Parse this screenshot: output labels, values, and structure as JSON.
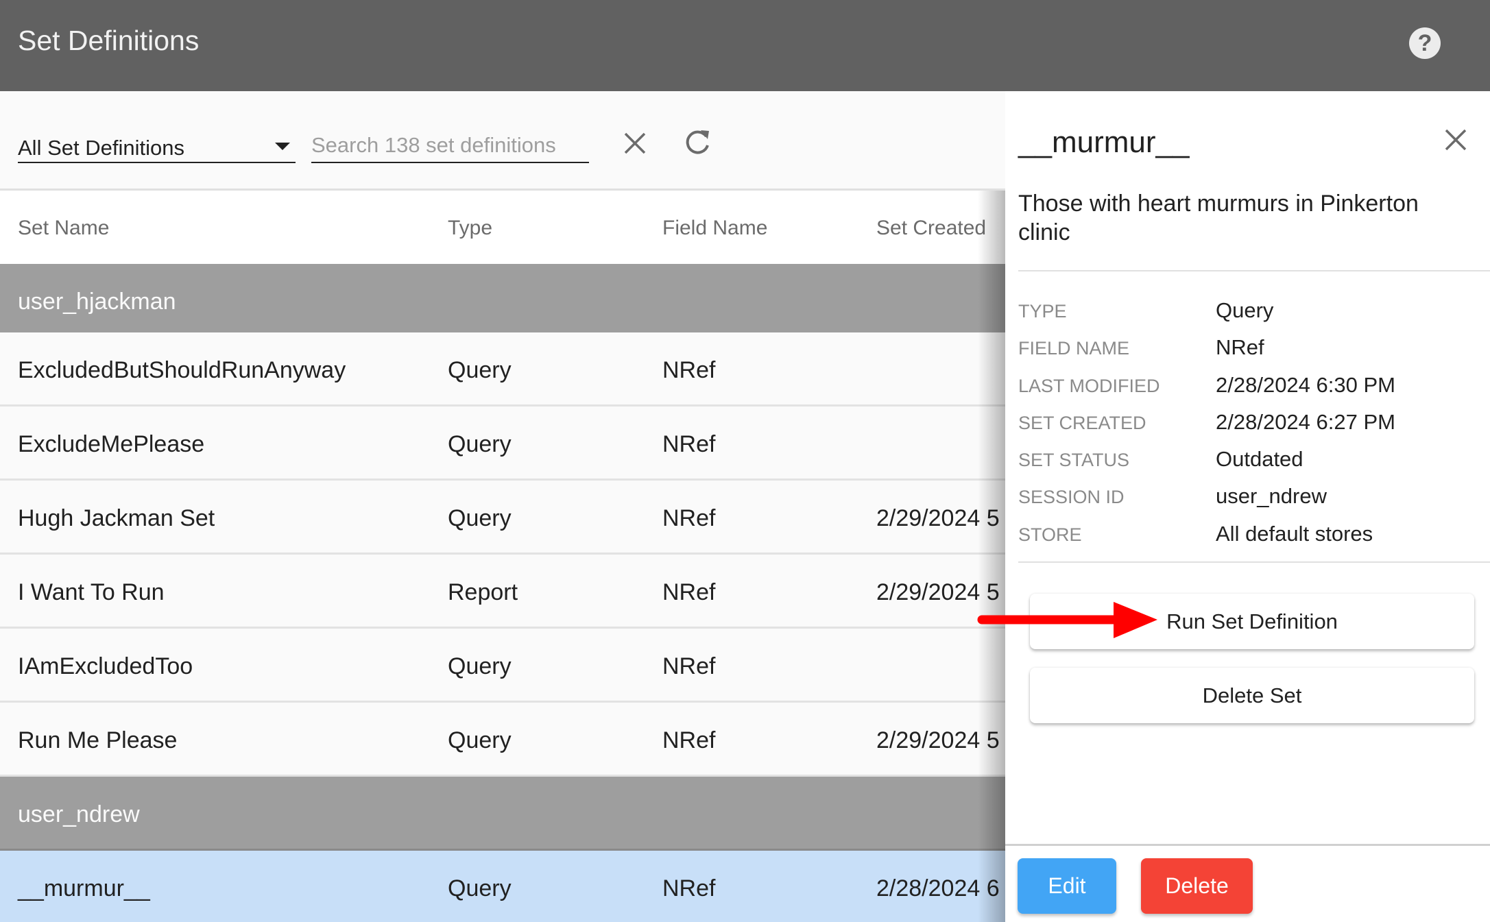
{
  "header": {
    "title": "Set Definitions",
    "help_icon": "help-circle-icon"
  },
  "toolbar": {
    "filter_select": {
      "selected": "All Set Definitions",
      "icon": "caret-down-icon"
    },
    "search": {
      "value": "",
      "placeholder": "Search 138 set definitions"
    },
    "clear_icon": "close-icon",
    "refresh_icon": "refresh-icon"
  },
  "table": {
    "columns": [
      "Set Name",
      "Type",
      "Field Name",
      "Set Created"
    ],
    "groups": [
      {
        "name": "user_hjackman",
        "rows": [
          {
            "set_name": "ExcludedButShouldRunAnyway",
            "type": "Query",
            "field_name": "NRef",
            "set_created": ""
          },
          {
            "set_name": "ExcludeMePlease",
            "type": "Query",
            "field_name": "NRef",
            "set_created": ""
          },
          {
            "set_name": "Hugh Jackman Set",
            "type": "Query",
            "field_name": "NRef",
            "set_created": "2/29/2024 5"
          },
          {
            "set_name": "I Want To Run",
            "type": "Report",
            "field_name": "NRef",
            "set_created": "2/29/2024 5"
          },
          {
            "set_name": "IAmExcludedToo",
            "type": "Query",
            "field_name": "NRef",
            "set_created": ""
          },
          {
            "set_name": "Run Me Please",
            "type": "Query",
            "field_name": "NRef",
            "set_created": "2/29/2024 5"
          }
        ]
      },
      {
        "name": "user_ndrew",
        "rows": [
          {
            "set_name": "__murmur__",
            "type": "Query",
            "field_name": "NRef",
            "set_created": "2/28/2024 6",
            "selected": true
          }
        ]
      }
    ]
  },
  "detail_panel": {
    "title": "__murmur__",
    "description": "Those with heart murmurs in Pinkerton clinic",
    "close_icon": "close-icon",
    "properties": [
      {
        "label": "Type",
        "value": "Query"
      },
      {
        "label": "Field Name",
        "value": "NRef"
      },
      {
        "label": "Last Modified",
        "value": "2/28/2024 6:30 PM"
      },
      {
        "label": "Set Created",
        "value": "2/28/2024 6:27 PM"
      },
      {
        "label": "Set Status",
        "value": "Outdated"
      },
      {
        "label": "Session ID",
        "value": "user_ndrew"
      },
      {
        "label": "Store",
        "value": "All default stores"
      }
    ],
    "actions": {
      "run_label": "Run Set Definition",
      "delete_set_label": "Delete Set"
    },
    "footer": {
      "edit_label": "Edit",
      "delete_label": "Delete"
    }
  },
  "colors": {
    "header_bg": "#616161",
    "group_row_bg": "#9E9E9E",
    "selected_row_bg": "#C8DFF8",
    "edit_button": "#42A5F5",
    "delete_button": "#F44336",
    "annotation_arrow": "#FF0000"
  },
  "annotation": {
    "type": "arrow",
    "points_to": "Run Set Definition"
  }
}
